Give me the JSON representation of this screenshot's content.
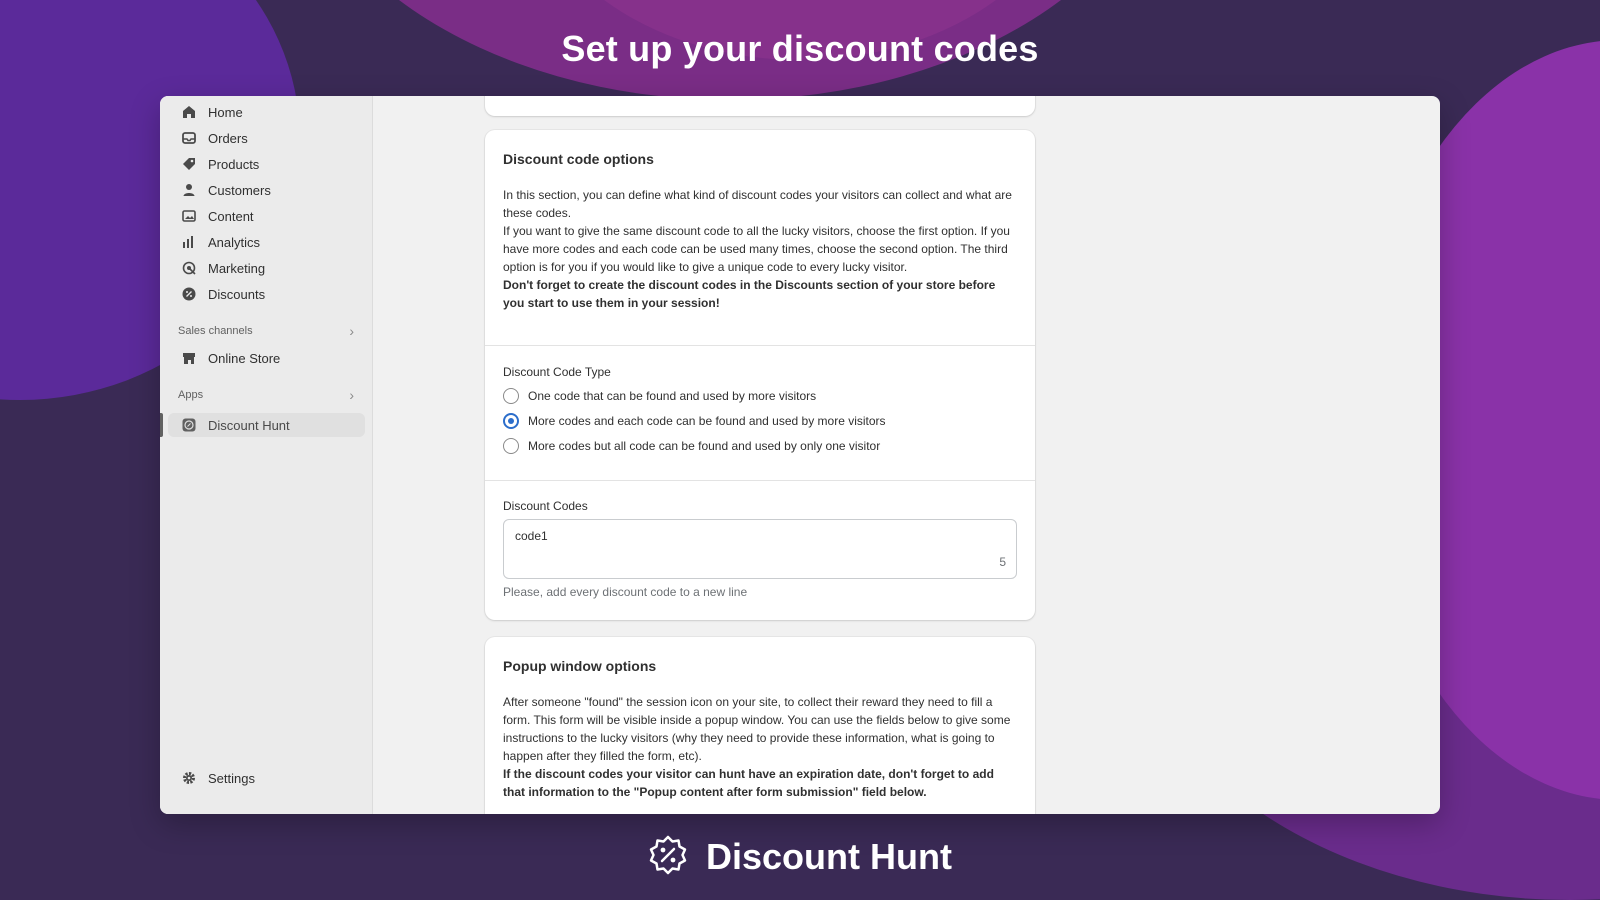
{
  "headline": "Set up your discount codes",
  "sidebar": {
    "items": [
      {
        "label": "Home",
        "icon": "home-icon"
      },
      {
        "label": "Orders",
        "icon": "inbox-icon"
      },
      {
        "label": "Products",
        "icon": "tag-icon"
      },
      {
        "label": "Customers",
        "icon": "person-icon"
      },
      {
        "label": "Content",
        "icon": "image-icon"
      },
      {
        "label": "Analytics",
        "icon": "bar-chart-icon"
      },
      {
        "label": "Marketing",
        "icon": "target-icon"
      },
      {
        "label": "Discounts",
        "icon": "discount-icon"
      }
    ],
    "sales_channels_label": "Sales channels",
    "online_store": "Online Store",
    "apps_label": "Apps",
    "discount_hunt": "Discount Hunt",
    "settings": "Settings"
  },
  "discount_options": {
    "title": "Discount code options",
    "desc_1": "In this section, you can define what kind of discount codes your visitors can collect and what are these codes.",
    "desc_2": "If you want to give the same discount code to all the lucky visitors, choose the first option. If you have more codes and each code can be used many times, choose the second option. The third option is for you if you would like to give a unique code to every lucky visitor.",
    "desc_bold": "Don't forget to create the discount codes in the Discounts section of your store before you start to use them in your session!",
    "type_label": "Discount Code Type",
    "options": [
      {
        "label": "One code that can be found and used by more visitors",
        "checked": false
      },
      {
        "label": "More codes and each code can be found and used by more visitors",
        "checked": true
      },
      {
        "label": "More codes but all code can be found and used by only one visitor",
        "checked": false
      }
    ],
    "codes_label": "Discount Codes",
    "codes_value": "code1",
    "codes_count": "5",
    "codes_help": "Please, add every discount code to a new line"
  },
  "popup_options": {
    "title": "Popup window options",
    "desc": "After someone \"found\" the session icon on your site, to collect their reward they need to fill a form. This form will be visible inside a popup window. You can use the fields below to give some instructions to the lucky visitors (why they need to provide these information, what is going to happen after they filled the form, etc).",
    "desc_bold": "If the discount codes your visitor can hunt have an expiration date, don't forget to add that information to the \"Popup content after form submission\" field below."
  },
  "footer": {
    "brand": "Discount Hunt",
    "icon": "discount-badge-icon"
  },
  "colors": {
    "accent": "#2c6ecb",
    "background": "#3a2a55"
  }
}
